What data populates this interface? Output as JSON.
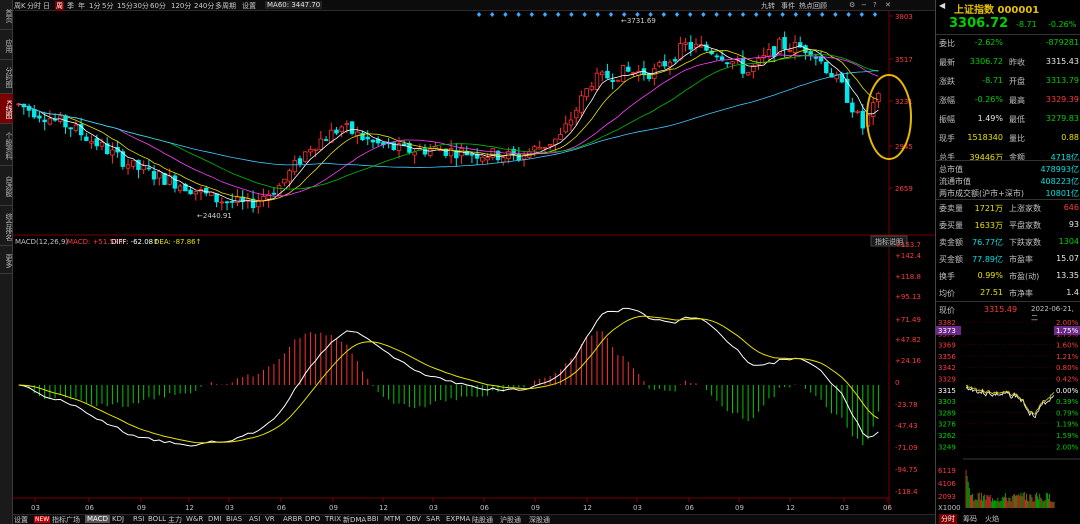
{
  "sidebar": {
    "items": [
      {
        "label": "首页"
      },
      {
        "label": "应用"
      },
      {
        "label": "分时图"
      },
      {
        "label": "K线图",
        "active": true
      },
      {
        "label": "个股资料"
      },
      {
        "label": "自选股"
      },
      {
        "label": "综合排名"
      },
      {
        "label": "更多"
      }
    ]
  },
  "toolbar": {
    "items": [
      "周K",
      "分时",
      "日",
      "周",
      "季",
      "年",
      "1分",
      "5分",
      "15分",
      "30分",
      "60分",
      "120分",
      "240分",
      "多周期",
      "设置"
    ],
    "active": "周",
    "ma_label": "MA60: 3447.70",
    "right_items": [
      "九转",
      "事件",
      "热点回顾"
    ]
  },
  "kline": {
    "y_ticks": [
      "3803",
      "3517",
      "3231",
      "2945",
      "2659"
    ],
    "high_label": "3731.69",
    "low_label": "2440.91"
  },
  "macd": {
    "header": "MACD(12,26,9)",
    "macd_val": "MACD: +51.57↑",
    "diff_val": "DIFF: -62.08↑",
    "dea_val": "DEA: -87.86↑",
    "help_button": "指标说明",
    "y_ticks": [
      "+153.7",
      "+142.4",
      "+118.8",
      "+95.13",
      "+71.49",
      "+47.82",
      "+24.16",
      "0",
      "-23.78",
      "-47.43",
      "-71.09",
      "-94.75",
      "-118.4"
    ]
  },
  "x_ticks": [
    "03",
    "06",
    "09",
    "12",
    "03",
    "06",
    "09",
    "12",
    "03",
    "06",
    "09",
    "12",
    "03",
    "06",
    "09",
    "12",
    "03",
    "06"
  ],
  "bottom_tabs": {
    "settings": "设置",
    "new_badge": "NEW",
    "items": [
      "指标广场",
      "MACD",
      "KDJ",
      "RSI",
      "BOLL",
      "主力",
      "W&R",
      "DMI",
      "BIAS",
      "ASI",
      "VR",
      "ARBR",
      "DPO",
      "TRIX",
      "新DMA",
      "BBI",
      "MTM",
      "OBV",
      "SAR",
      "EXPMA",
      "陆股通",
      "沪股通",
      "深股通"
    ],
    "active": "MACD"
  },
  "panel": {
    "title": "上证指数 000001",
    "price": "3306.72",
    "change": "-8.71",
    "change_pct": "-0.26%",
    "rows": [
      {
        "l": "委比",
        "v1": "-2.62%",
        "c1": "green",
        "l2": "",
        "v2": "-879281",
        "c2": "green"
      },
      {
        "l": "最新",
        "v1": "3306.72",
        "c1": "green",
        "l2": "昨收",
        "v2": "3315.43",
        "c2": "white"
      },
      {
        "l": "涨跌",
        "v1": "-8.71",
        "c1": "green",
        "l2": "开盘",
        "v2": "3313.79",
        "c2": "green"
      },
      {
        "l": "涨幅",
        "v1": "-0.26%",
        "c1": "green",
        "l2": "最高",
        "v2": "3329.39",
        "c2": "red"
      },
      {
        "l": "振幅",
        "v1": "1.49%",
        "c1": "white",
        "l2": "最低",
        "v2": "3279.83",
        "c2": "green"
      },
      {
        "l": "现手",
        "v1": "1518340",
        "c1": "yellow",
        "l2": "量比",
        "v2": "0.88",
        "c2": "yellow"
      },
      {
        "l": "总手",
        "v1": "39446万",
        "c1": "yellow",
        "l2": "金额",
        "v2": "4718亿",
        "c2": "cyan"
      }
    ],
    "mkt_rows": [
      {
        "l": "总市值",
        "v": "478993亿"
      },
      {
        "l": "流通市值",
        "v": "408223亿"
      },
      {
        "l": "两市成交额(沪市+深市)",
        "v": "10801亿"
      }
    ],
    "stat_rows": [
      {
        "l": "委卖量",
        "v1": "1721万",
        "c1": "yellow",
        "l2": "上涨家数",
        "v2": "646",
        "c2": "red"
      },
      {
        "l": "委买量",
        "v1": "1633万",
        "c1": "yellow",
        "l2": "平盘家数",
        "v2": "93",
        "c2": "white"
      },
      {
        "l": "卖金额",
        "v1": "76.77亿",
        "c1": "cyan",
        "l2": "下跌家数",
        "v2": "1304",
        "c2": "green"
      },
      {
        "l": "买金额",
        "v1": "77.89亿",
        "c1": "cyan",
        "l2": "市盈率",
        "v2": "15.07",
        "c2": "white"
      },
      {
        "l": "换手",
        "v1": "0.99%",
        "c1": "yellow",
        "l2": "市盈(动)",
        "v2": "13.35",
        "c2": "white"
      },
      {
        "l": "均价",
        "v1": "27.51",
        "c1": "yellow",
        "l2": "市净率",
        "v2": "1.4",
        "c2": "white"
      }
    ],
    "quote_label": "现价",
    "quote_value": "3315.49",
    "quote_date": "2022-06-21,二",
    "mini_ticks_left": [
      "3382",
      "3373",
      "3369",
      "3356",
      "3342",
      "3329",
      "3315",
      "3303",
      "3289",
      "3276",
      "3262",
      "3249"
    ],
    "mini_ticks_right": [
      "2.00%",
      "1.75%",
      "1.60%",
      "1.21%",
      "0.80%",
      "0.42%",
      "0.00%",
      "0.39%",
      "0.79%",
      "1.19%",
      "1.59%",
      "2.00%"
    ],
    "vol_ticks": [
      "6119",
      "4106",
      "2093",
      "X1000"
    ],
    "tabs": [
      "分时",
      "筹码",
      "火焰"
    ],
    "active_tab": "分时"
  }
}
